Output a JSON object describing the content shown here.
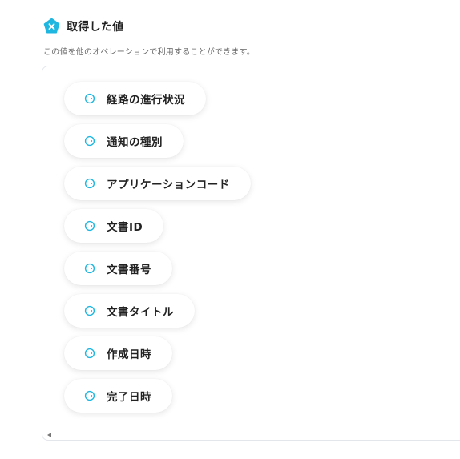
{
  "header": {
    "title": "取得した値",
    "icon": "variable-x-icon",
    "icon_color": "#1fb6e0"
  },
  "description": "この値を他のオペレーションで利用することができます。",
  "values": [
    {
      "label": "経路の進行状況"
    },
    {
      "label": "通知の種別"
    },
    {
      "label": "アプリケーションコード"
    },
    {
      "label": "文書ID"
    },
    {
      "label": "文書番号"
    },
    {
      "label": "文書タイトル"
    },
    {
      "label": "作成日時"
    },
    {
      "label": "完了日時"
    }
  ],
  "chip_icon": "value-token-icon",
  "chip_icon_color": "#1fb6e0"
}
